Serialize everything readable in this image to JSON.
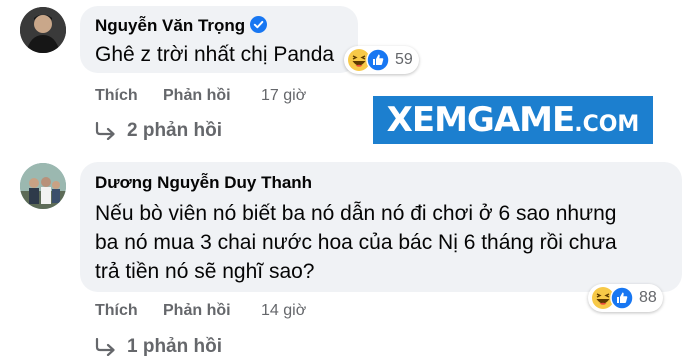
{
  "comments": [
    {
      "author": "Nguyễn Văn Trọng",
      "verified": true,
      "text": "Ghê z trời nhất chị Panda",
      "reaction_count": "59",
      "actions": {
        "like": "Thích",
        "reply": "Phản hồi",
        "time": "17 giờ"
      },
      "replies_label": "2 phản hồi"
    },
    {
      "author": "Dương Nguyễn Duy Thanh",
      "verified": false,
      "text_lines": [
        "Nếu bò viên nó biết ba nó dẫn nó đi chơi ở 6 sao nhưng",
        "ba nó mua 3 chai nước hoa của bác Nị 6 tháng rồi chưa",
        "trả tiền nó sẽ nghĩ sao?"
      ],
      "reaction_count": "88",
      "actions": {
        "like": "Thích",
        "reply": "Phản hồi",
        "time": "14 giờ"
      },
      "replies_label": "1 phản hồi"
    }
  ],
  "watermark": {
    "main": "XEMGAME",
    "suffix": ".COM"
  },
  "colors": {
    "bubble": "#f0f2f5",
    "meta": "#65676b",
    "like_blue": "#1877f2",
    "haha_yellow": "#f7c948",
    "watermark_bg": "#1c7fcf"
  },
  "icons": [
    "verified-badge-icon",
    "haha-reaction-icon",
    "like-reaction-icon",
    "reply-arrow-icon"
  ]
}
